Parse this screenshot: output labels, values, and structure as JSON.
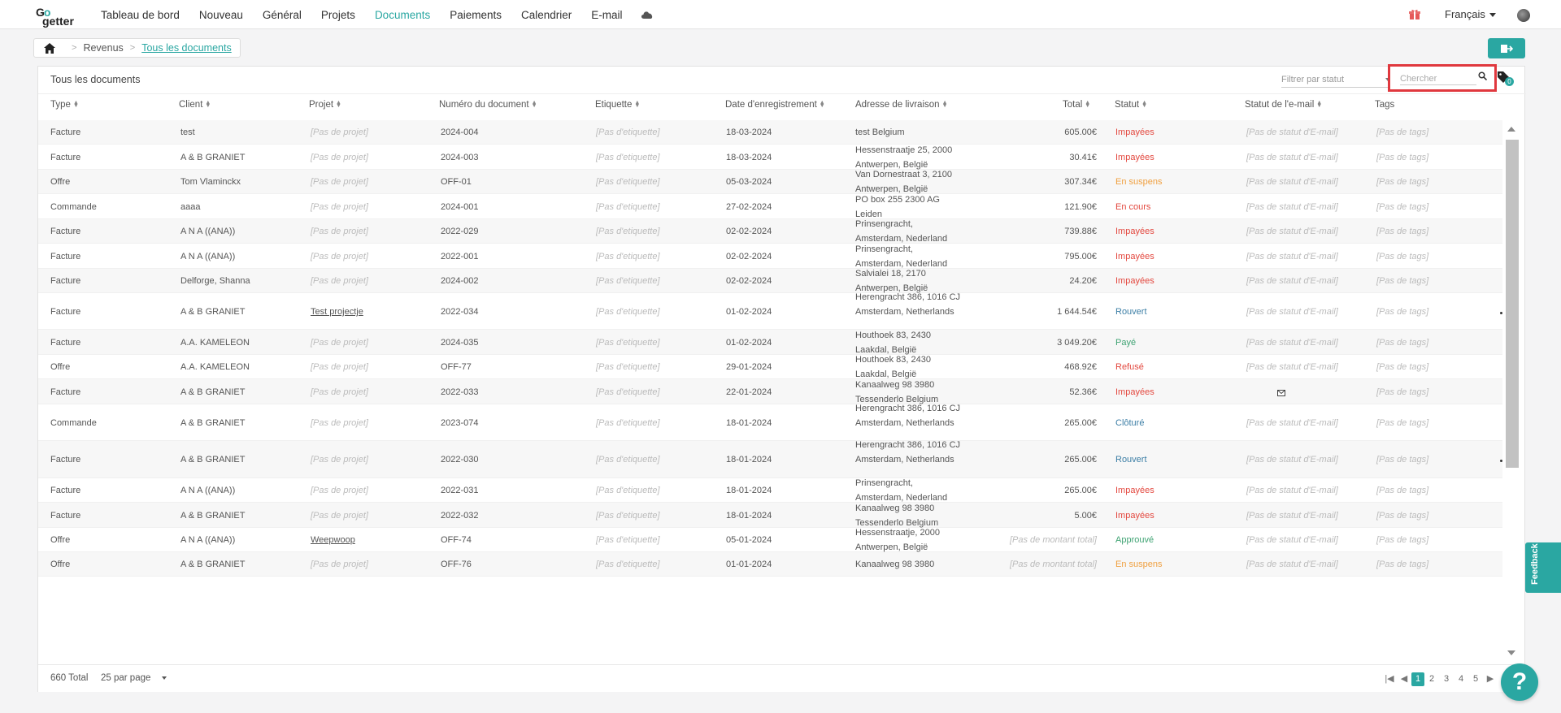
{
  "logo": {
    "line1_a": "G",
    "line1_b": "o",
    "line2": "getter"
  },
  "nav": [
    {
      "label": "Tableau de bord",
      "active": false
    },
    {
      "label": "Nouveau",
      "active": false
    },
    {
      "label": "Général",
      "active": false
    },
    {
      "label": "Projets",
      "active": false
    },
    {
      "label": "Documents",
      "active": true
    },
    {
      "label": "Paiements",
      "active": false
    },
    {
      "label": "Calendrier",
      "active": false
    },
    {
      "label": "E-mail",
      "active": false
    }
  ],
  "language": "Français",
  "breadcrumb": {
    "item1": "Revenus",
    "item2": "Tous les documents"
  },
  "panel": {
    "title": "Tous les documents",
    "filter_placeholder": "Filtrer par statut",
    "search_placeholder": "Chercher",
    "tag_badge": "0"
  },
  "columns": {
    "type": "Type",
    "client": "Client",
    "project": "Projet",
    "number": "Numéro du document",
    "label": "Etiquette",
    "date": "Date d'enregistrement",
    "address": "Adresse de livraison",
    "total": "Total",
    "status": "Statut",
    "email_status": "Statut de l'e-mail",
    "tags": "Tags"
  },
  "placeholders": {
    "project": "[Pas de projet]",
    "label": "[Pas d'etiquette]",
    "email_status": "[Pas de statut d'E-mail]",
    "tags": "[Pas de tags]",
    "total": "[Pas de montant total]"
  },
  "rows": [
    {
      "type": "Facture",
      "client": "test",
      "project": "",
      "number": "2024-004",
      "date": "18-03-2024",
      "address": "test Belgium",
      "total": "605.00€",
      "status": "Impayées",
      "status_color": "#e3483f",
      "email_icon": false
    },
    {
      "type": "Facture",
      "client": "A & B GRANIET",
      "project": "",
      "number": "2024-003",
      "date": "18-03-2024",
      "address": "Hessenstraatje 25, 2000 Antwerpen, België",
      "total": "30.41€",
      "status": "Impayées",
      "status_color": "#e3483f",
      "email_icon": false
    },
    {
      "type": "Offre",
      "client": "Tom Vlaminckx",
      "project": "",
      "number": "OFF-01",
      "date": "05-03-2024",
      "address": "Van Dornestraat 3, 2100 Antwerpen, België",
      "total": "307.34€",
      "status": "En suspens",
      "status_color": "#f0a040",
      "email_icon": false
    },
    {
      "type": "Commande",
      "client": "aaaa",
      "project": "",
      "number": "2024-001",
      "date": "27-02-2024",
      "address": "PO box 255 2300 AG Leiden",
      "total": "121.90€",
      "status": "En cours",
      "status_color": "#e3483f",
      "email_icon": false
    },
    {
      "type": "Facture",
      "client": "A N A ((ANA))",
      "project": "",
      "number": "2022-029",
      "date": "02-02-2024",
      "address": "Prinsengracht, Amsterdam, Nederland",
      "total": "739.88€",
      "status": "Impayées",
      "status_color": "#e3483f",
      "email_icon": false
    },
    {
      "type": "Facture",
      "client": "A N A ((ANA))",
      "project": "",
      "number": "2022-001",
      "date": "02-02-2024",
      "address": "Prinsengracht, Amsterdam, Nederland",
      "total": "795.00€",
      "status": "Impayées",
      "status_color": "#e3483f",
      "email_icon": false
    },
    {
      "type": "Facture",
      "client": "Delforge, Shanna",
      "project": "",
      "number": "2024-002",
      "date": "02-02-2024",
      "address": "Salvialei 18, 2170 Antwerpen, België",
      "total": "24.20€",
      "status": "Impayées",
      "status_color": "#e3483f",
      "email_icon": false
    },
    {
      "type": "Facture",
      "client": "A & B GRANIET",
      "project": "Test projectje",
      "number": "2022-034",
      "date": "01-02-2024",
      "address": "Herengracht 386, 1016 CJ Amsterdam, Netherlands",
      "total": "1 644.54€",
      "status": "Rouvert",
      "status_color": "#3d7fa6",
      "email_icon": false
    },
    {
      "type": "Facture",
      "client": "A.A. KAMELEON",
      "project": "",
      "number": "2024-035",
      "date": "01-02-2024",
      "address": "Houthoek 83, 2430 Laakdal, België",
      "total": "3 049.20€",
      "status": "Payé",
      "status_color": "#3fa373",
      "email_icon": false
    },
    {
      "type": "Offre",
      "client": "A.A. KAMELEON",
      "project": "",
      "number": "OFF-77",
      "date": "29-01-2024",
      "address": "Houthoek 83, 2430 Laakdal, België",
      "total": "468.92€",
      "status": "Refusé",
      "status_color": "#e3483f",
      "email_icon": false
    },
    {
      "type": "Facture",
      "client": "A & B GRANIET",
      "project": "",
      "number": "2022-033",
      "date": "22-01-2024",
      "address": "Kanaalweg 98 3980 Tessenderlo Belgium",
      "total": "52.36€",
      "status": "Impayées",
      "status_color": "#e3483f",
      "email_icon": true
    },
    {
      "type": "Commande",
      "client": "A & B GRANIET",
      "project": "",
      "number": "2023-074",
      "date": "18-01-2024",
      "address": "Herengracht 386, 1016 CJ Amsterdam, Netherlands",
      "total": "265.00€",
      "status": "Clôturé",
      "status_color": "#3d7fa6",
      "email_icon": false
    },
    {
      "type": "Facture",
      "client": "A & B GRANIET",
      "project": "",
      "number": "2022-030",
      "date": "18-01-2024",
      "address": "Herengracht 386, 1016 CJ Amsterdam, Netherlands",
      "total": "265.00€",
      "status": "Rouvert",
      "status_color": "#3d7fa6",
      "email_icon": false
    },
    {
      "type": "Facture",
      "client": "A N A ((ANA))",
      "project": "",
      "number": "2022-031",
      "date": "18-01-2024",
      "address": "Prinsengracht, Amsterdam, Nederland",
      "total": "265.00€",
      "status": "Impayées",
      "status_color": "#e3483f",
      "email_icon": false
    },
    {
      "type": "Facture",
      "client": "A & B GRANIET",
      "project": "",
      "number": "2022-032",
      "date": "18-01-2024",
      "address": "Kanaalweg 98 3980 Tessenderlo Belgium",
      "total": "5.00€",
      "status": "Impayées",
      "status_color": "#e3483f",
      "email_icon": false
    },
    {
      "type": "Offre",
      "client": "A N A ((ANA))",
      "project": "Weepwoop",
      "number": "OFF-74",
      "date": "05-01-2024",
      "address": "Hessenstraatje, 2000 Antwerpen, België",
      "total": "",
      "status": "Approuvé",
      "status_color": "#3fa373",
      "email_icon": false
    },
    {
      "type": "Offre",
      "client": "A & B GRANIET",
      "project": "",
      "number": "OFF-76",
      "date": "01-01-2024",
      "address": "Kanaalweg 98 3980",
      "total": "",
      "status": "En suspens",
      "status_color": "#f0a040",
      "email_icon": false
    }
  ],
  "footer": {
    "total_count": "660 Total",
    "per_page": "25 par page",
    "pages": [
      "1",
      "2",
      "3",
      "4",
      "5"
    ]
  },
  "feedback_label": "Feedback",
  "help_label": "?"
}
